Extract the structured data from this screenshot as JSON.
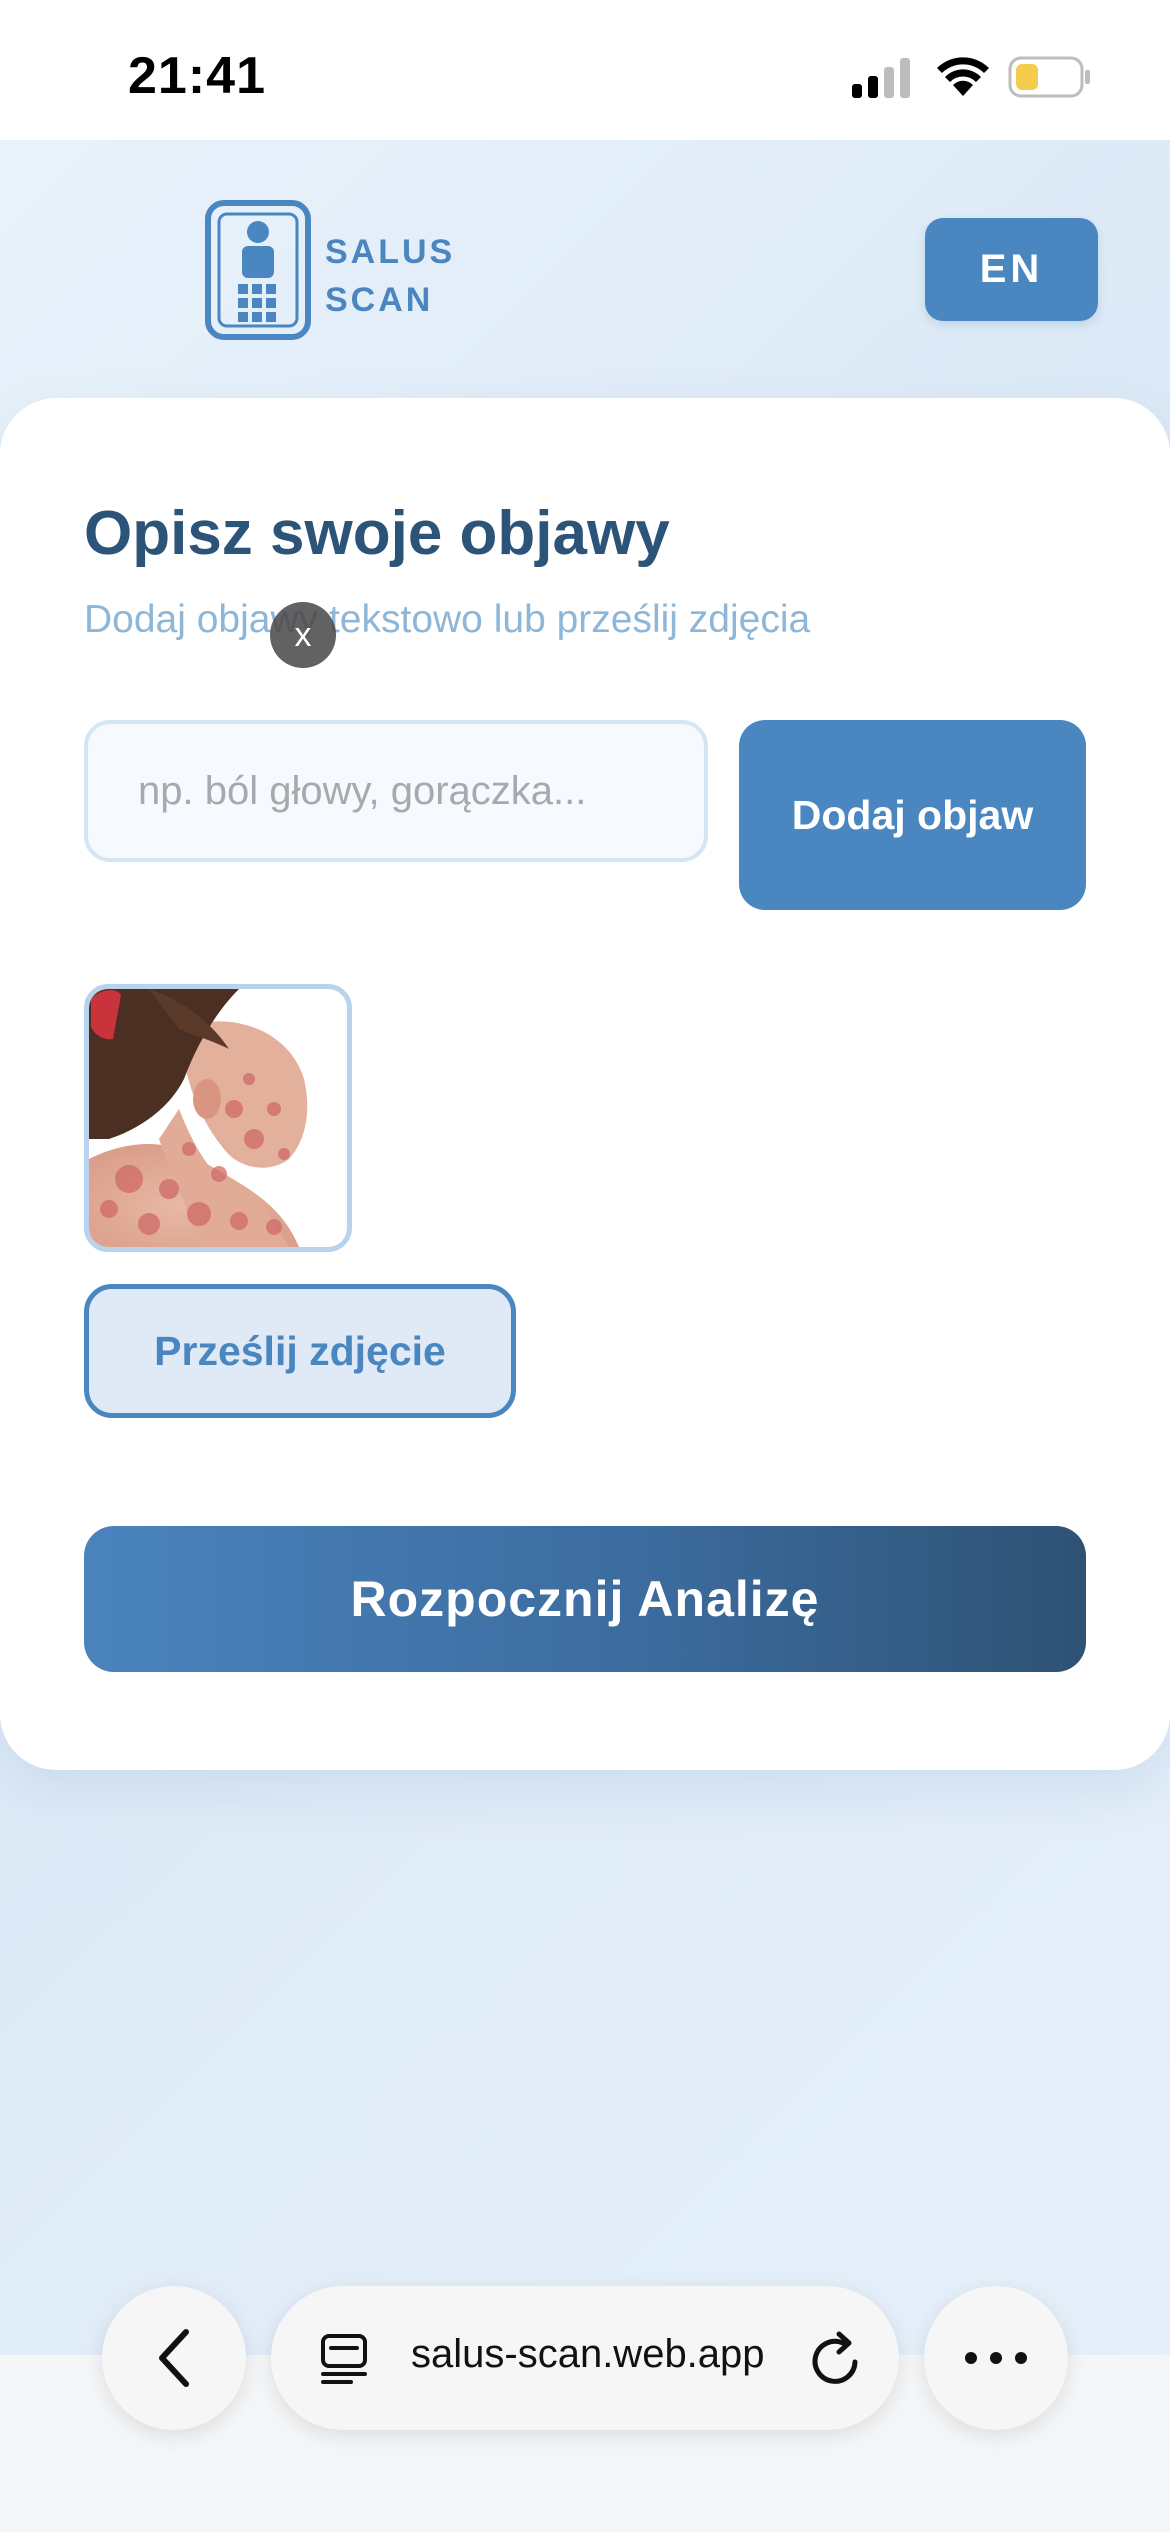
{
  "status_bar": {
    "time": "21:41",
    "icons": [
      "signal-icon",
      "wifi-icon",
      "battery-icon"
    ],
    "battery_color": "#f5cd4c"
  },
  "header": {
    "logo_line1": "SALUS",
    "logo_line2": "SCAN",
    "lang_button": "EN"
  },
  "card": {
    "title": "Opisz swoje objawy",
    "subtitle": "Dodaj objawy tekstowo lub prześlij zdjęcia",
    "symptom_input": {
      "value": "",
      "placeholder": "np. ból głowy, gorączka..."
    },
    "add_symptom_button": "Dodaj objaw",
    "photo": {
      "remove_label": "x"
    },
    "upload_photo_button": "Prześlij zdjęcie",
    "start_analysis_button": "Rozpocznij Analizę"
  },
  "browser": {
    "url": "salus-scan.web.app",
    "icons": [
      "chevron-left-icon",
      "tabs-icon",
      "reload-icon",
      "more-icon"
    ]
  },
  "colors": {
    "accent": "#4a86c0",
    "title": "#2c5378",
    "subtitle": "#8db6d8"
  }
}
